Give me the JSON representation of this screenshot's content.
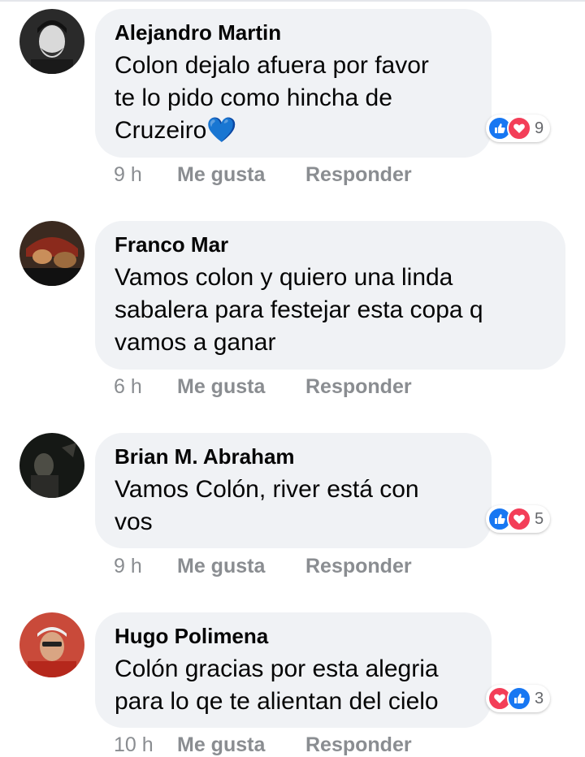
{
  "comments": [
    {
      "author": "Alejandro Martin",
      "text": "Colon dejalo afuera por favor\nte lo pido como hincha de\nCruzeiro💙",
      "time": "9 h",
      "like_label": "Me gusta",
      "reply_label": "Responder",
      "reaction_count": "9",
      "reactions": [
        "like-icon",
        "love-icon"
      ]
    },
    {
      "author": "Franco Mar",
      "text": "Vamos colon y quiero una linda\nsabalera para festejar esta copa q\nvamos a ganar",
      "time": "6 h",
      "like_label": "Me gusta",
      "reply_label": "Responder"
    },
    {
      "author": "Brian M. Abraham",
      "text": "Vamos Colón, river está con\nvos",
      "time": "9 h",
      "like_label": "Me gusta",
      "reply_label": "Responder",
      "reaction_count": "5",
      "reactions": [
        "like-icon",
        "love-icon"
      ]
    },
    {
      "author": "Hugo Polimena",
      "text": "Colón gracias por esta alegria\npara lo qe te alientan del cielo",
      "time": "10 h",
      "like_label": "Me gusta",
      "reply_label": "Responder",
      "reaction_count": "3",
      "reactions": [
        "love-icon",
        "like-icon"
      ]
    }
  ],
  "colors": {
    "like": "#1877f2",
    "love": "#f33e58",
    "bubble": "#f0f2f5",
    "meta_text": "#8a8d91"
  }
}
